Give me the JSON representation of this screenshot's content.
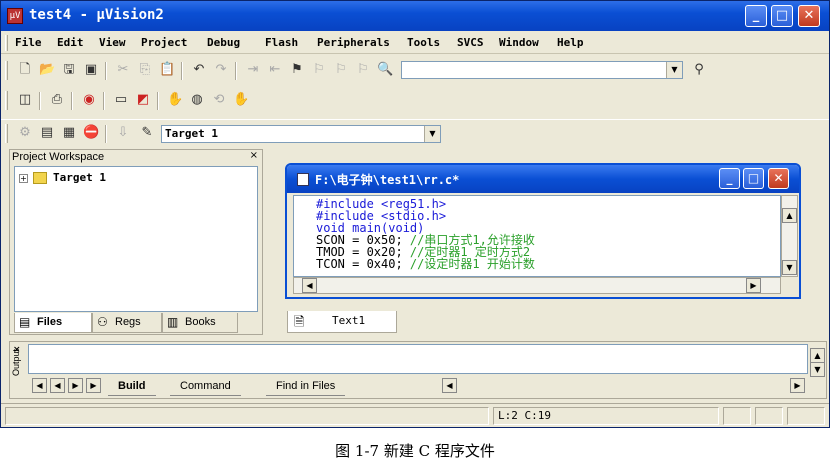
{
  "window": {
    "app_icon_label": "µV",
    "title": "test4  - µVision2"
  },
  "menu": [
    "File",
    "Edit",
    "View",
    "Project",
    "Debug",
    "Flash",
    "Peripherals",
    "Tools",
    "SVCS",
    "Window",
    "Help"
  ],
  "toolbar1": {
    "icons": [
      "new-file-icon",
      "open-folder-icon",
      "save-icon",
      "save-all-icon",
      "cut-icon",
      "copy-icon",
      "paste-icon",
      "undo-icon",
      "redo-icon",
      "indent-icon",
      "unindent-icon",
      "bookmark-icon",
      "prev-bookmark-icon",
      "next-bookmark-icon",
      "clear-bookmarks-icon",
      "find-in-files-icon"
    ],
    "find_combo_value": "",
    "binoculars_icon": "binoculars-icon"
  },
  "toolbar2": {
    "icons": [
      "source-browser-icon",
      "print-icon",
      "debug-icon",
      "window-icon",
      "breakpoint-window-icon",
      "hand-icon",
      "watch-icon",
      "reset-icon",
      "stop-icon"
    ]
  },
  "toolbar3": {
    "icons": [
      "compile-icon",
      "build-icon",
      "rebuild-icon",
      "stop-build-icon",
      "download-icon",
      "options-icon"
    ],
    "target_combo_value": "Target 1"
  },
  "workspace": {
    "title": "Project Workspace",
    "close_glyph": "×",
    "tree": [
      {
        "label": "Target 1",
        "expanded": false
      }
    ],
    "tabs": [
      {
        "label": "Files",
        "icon": "files-icon",
        "active": true
      },
      {
        "label": "Regs",
        "icon": "regs-icon",
        "active": false
      },
      {
        "label": "Books",
        "icon": "books-icon",
        "active": false
      }
    ]
  },
  "editor": {
    "title": "F:\\电子钟\\test1\\rr.c*",
    "lines": [
      {
        "code": "#include <reg51.h>",
        "comment": ""
      },
      {
        "code": "#include <stdio.h>",
        "comment": ""
      },
      {
        "code": "void main(void)",
        "comment": ""
      },
      {
        "code": "SCON = 0x50; ",
        "comment": "//串口方式1,允许接收"
      },
      {
        "code": "TMOD = 0x20; ",
        "comment": "//定时器1 定时方式2"
      },
      {
        "code": "TCON = 0x40; ",
        "comment": "//设定时器1 开始计数"
      }
    ],
    "doc_tab_label": "Text1"
  },
  "output": {
    "close_glyph": "×",
    "vertical_label": "Output",
    "tabs": [
      {
        "label": "Build",
        "active": true
      },
      {
        "label": "Command",
        "active": false
      },
      {
        "label": "Find in Files",
        "active": false
      }
    ]
  },
  "status": {
    "cursor_position": "L:2 C:19"
  },
  "caption": "图 1-7  新建 C 程序文件"
}
